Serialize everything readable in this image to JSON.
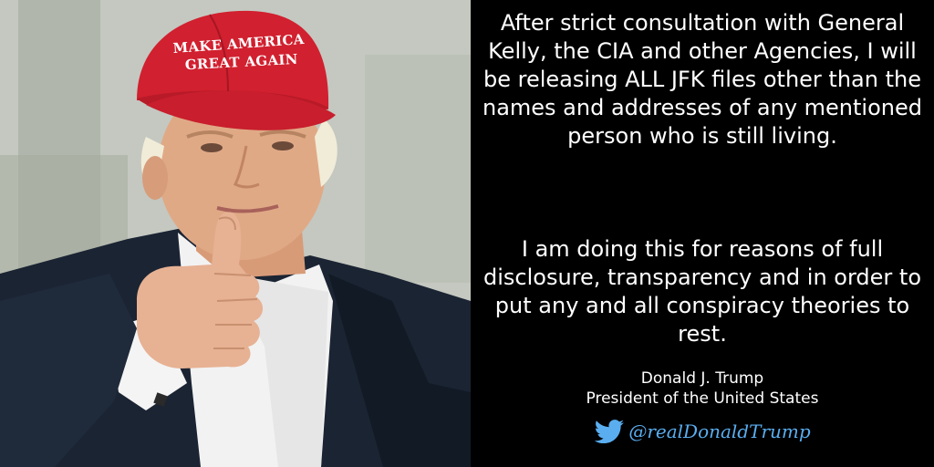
{
  "photo": {
    "cap_line1": "MAKE AMERICA",
    "cap_line2": "GREAT AGAIN",
    "colors": {
      "cap": "#d1202f",
      "suit": "#1b2433",
      "shirt": "#f2f2f2",
      "skin": "#e0a986"
    }
  },
  "tweet": {
    "paragraph1": "After strict consultation with General Kelly, the CIA and other Agencies, I will be releasing ALL JFK files other than the names and addresses of any mentioned person who is still living.",
    "paragraph2": "I am doing this for reasons of full disclosure, transparency and in order to put any and all conspiracy theories to rest.",
    "author_name": "Donald J. Trump",
    "author_title": "President of the United States",
    "handle": "@realDonaldTrump",
    "handle_icon": "twitter-bird-icon",
    "colors": {
      "background": "#000000",
      "text": "#ffffff",
      "handle": "#5aaef0"
    }
  }
}
